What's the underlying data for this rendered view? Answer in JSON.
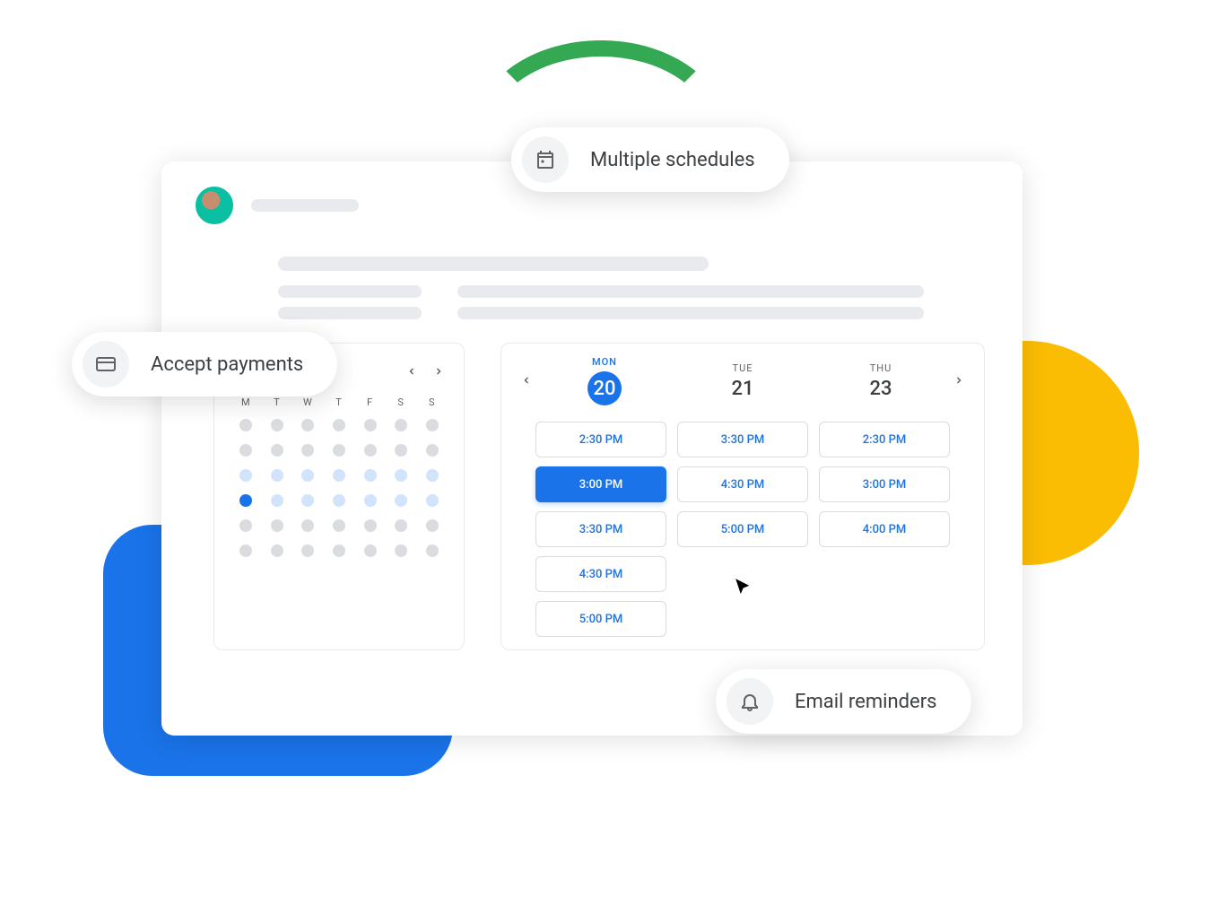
{
  "pills": {
    "schedules": "Multiple schedules",
    "payments": "Accept payments",
    "reminders": "Email reminders"
  },
  "mini_month": {
    "dow": [
      "M",
      "T",
      "W",
      "T",
      "F",
      "S",
      "S"
    ],
    "grid": [
      [
        "g",
        "g",
        "g",
        "g",
        "g",
        "g",
        "g"
      ],
      [
        "g",
        "g",
        "g",
        "g",
        "g",
        "g",
        "g"
      ],
      [
        "lb",
        "lb",
        "lb",
        "lb",
        "lb",
        "lb",
        "lb"
      ],
      [
        "db",
        "lb",
        "lb",
        "lb",
        "lb",
        "lb",
        "lb"
      ],
      [
        "g",
        "g",
        "g",
        "g",
        "g",
        "g",
        "g"
      ],
      [
        "g",
        "g",
        "g",
        "g",
        "g",
        "g",
        "g"
      ]
    ]
  },
  "days": [
    {
      "dow": "MON",
      "num": "20",
      "active": true,
      "slots": [
        "2:30 PM",
        "3:00 PM",
        "3:30 PM",
        "4:30 PM",
        "5:00 PM"
      ]
    },
    {
      "dow": "TUE",
      "num": "21",
      "active": false,
      "slots": [
        "3:30 PM",
        "4:30 PM",
        "5:00 PM"
      ]
    },
    {
      "dow": "THU",
      "num": "23",
      "active": false,
      "slots": [
        "2:30 PM",
        "3:00 PM",
        "4:00 PM"
      ]
    }
  ],
  "selected_slot": "3:00 PM"
}
